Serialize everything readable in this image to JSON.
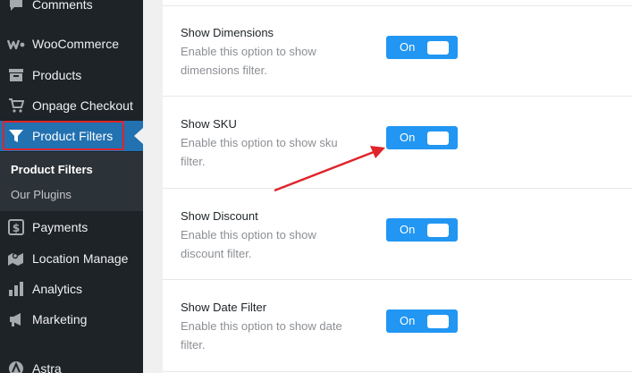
{
  "sidebar": {
    "items": [
      {
        "label": "Comments",
        "icon": "comment-icon"
      },
      {
        "label": "WooCommerce",
        "icon": "woocommerce-icon"
      },
      {
        "label": "Products",
        "icon": "archive-icon"
      },
      {
        "label": "Onpage Checkout",
        "icon": "cart-icon"
      },
      {
        "label": "Product Filters",
        "icon": "filter-icon"
      },
      {
        "label": "Payments",
        "icon": "dollar-icon"
      },
      {
        "label": "Location Manage",
        "icon": "map-pin-icon"
      },
      {
        "label": "Analytics",
        "icon": "bar-chart-icon"
      },
      {
        "label": "Marketing",
        "icon": "megaphone-icon"
      },
      {
        "label": "Astra",
        "icon": "astra-icon"
      }
    ],
    "submenu": [
      {
        "label": "Product Filters"
      },
      {
        "label": "Our Plugins"
      }
    ],
    "colors": {
      "bg": "#1d2327",
      "active": "#2271b1",
      "highlight_border": "#e0242b"
    }
  },
  "settings": [
    {
      "title": "Show Dimensions",
      "description": "Enable this option to show dimensions filter.",
      "toggle": "On"
    },
    {
      "title": "Show SKU",
      "description": "Enable this option to show sku filter.",
      "toggle": "On"
    },
    {
      "title": "Show Discount",
      "description": "Enable this option to show discount filter.",
      "toggle": "On"
    },
    {
      "title": "Show Date Filter",
      "description": "Enable this option to show date filter.",
      "toggle": "On"
    }
  ],
  "colors": {
    "toggle_on": "#2196f3",
    "annotation_arrow": "#e0242b"
  }
}
